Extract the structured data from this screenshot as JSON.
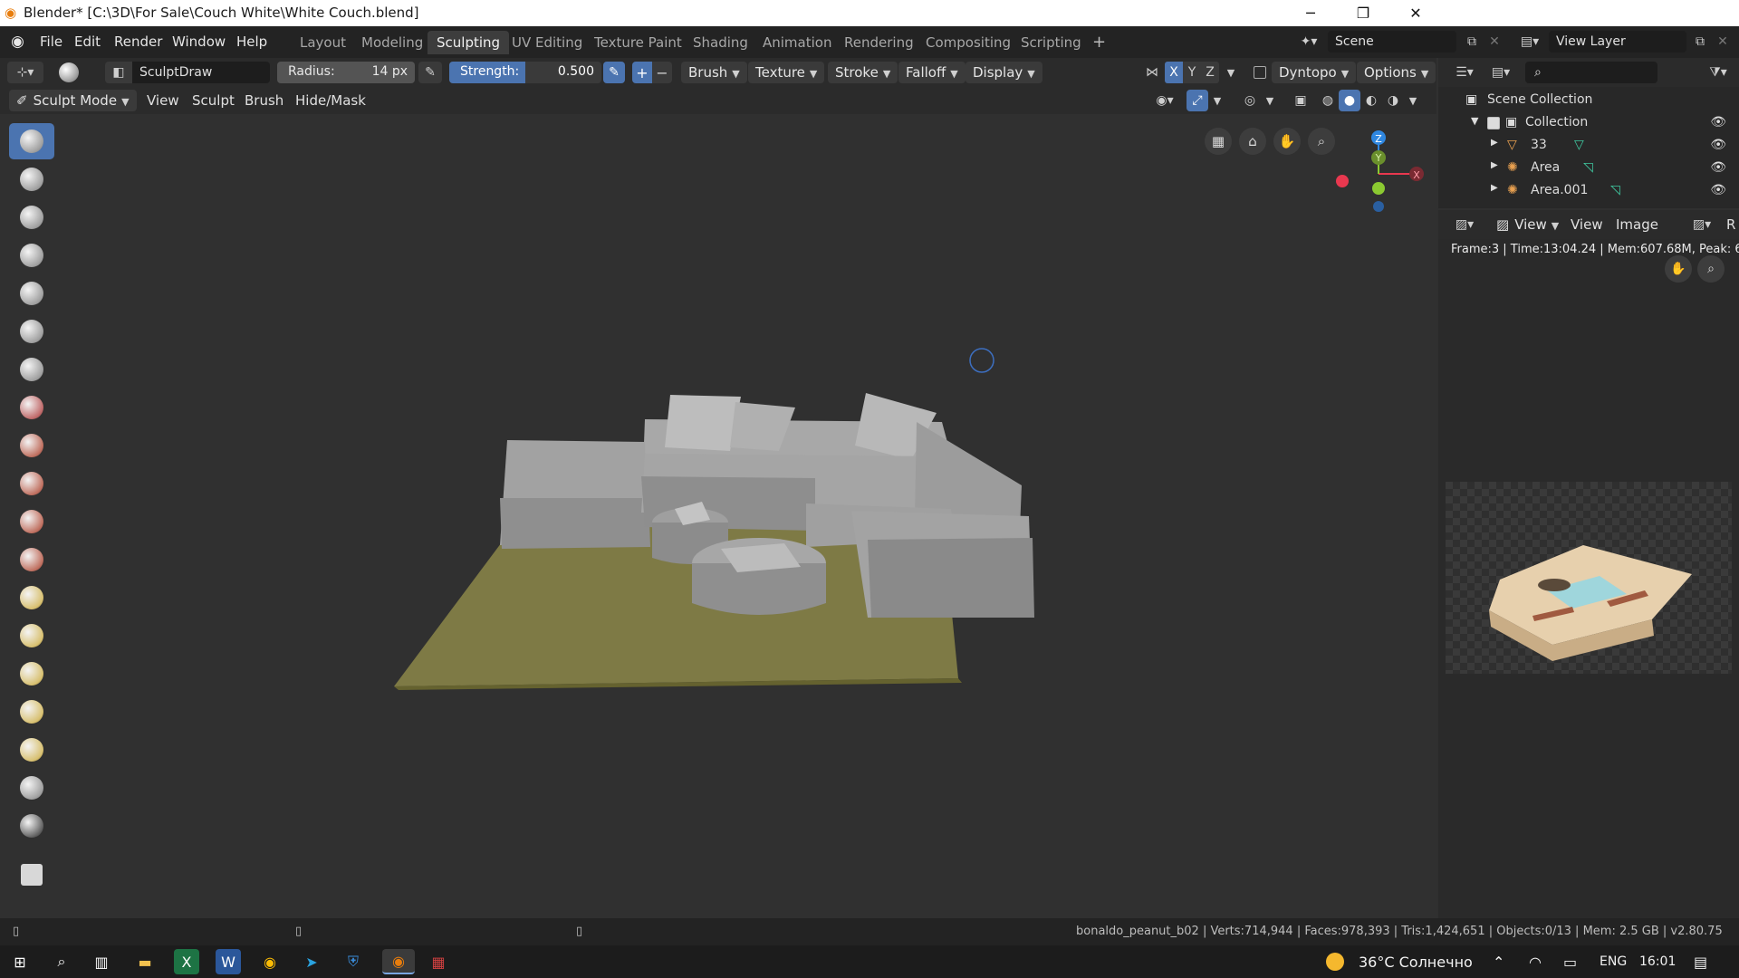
{
  "window": {
    "title": "Blender* [C:\\3D\\For Sale\\Couch White\\White Couch.blend]",
    "minimize": "─",
    "restore": "❐",
    "close": "✕"
  },
  "menu": {
    "file": "File",
    "edit": "Edit",
    "render": "Render",
    "window": "Window",
    "help": "Help"
  },
  "workspaces": {
    "layout": "Layout",
    "modeling": "Modeling",
    "sculpting": "Sculpting",
    "uv": "UV Editing",
    "texture": "Texture Paint",
    "shading": "Shading",
    "animation": "Animation",
    "rendering": "Rendering",
    "compositing": "Compositing",
    "scripting": "Scripting",
    "add": "+"
  },
  "scene": {
    "name": "Scene",
    "view_layer": "View Layer"
  },
  "tool_header": {
    "brush_name": "SculptDraw",
    "radius_label": "Radius:",
    "radius_value": "14 px",
    "strength_label": "Strength:",
    "strength_value": "0.500",
    "brush": "Brush",
    "texture": "Texture",
    "stroke": "Stroke",
    "falloff": "Falloff",
    "display": "Display",
    "axis_x": "X",
    "axis_y": "Y",
    "axis_z": "Z",
    "dyntopo": "Dyntopo",
    "options": "Options"
  },
  "view_header": {
    "mode": "Sculpt Mode",
    "view": "View",
    "sculpt": "Sculpt",
    "brush": "Brush",
    "hide_mask": "Hide/Mask"
  },
  "gizmo": {
    "z": "Z",
    "y": "Y",
    "x": "X"
  },
  "outliner": {
    "scene_collection": "Scene Collection",
    "items": [
      {
        "label": "Collection"
      },
      {
        "label": "33"
      },
      {
        "label": "Area"
      },
      {
        "label": "Area.001"
      }
    ]
  },
  "image_editor": {
    "view1": "View",
    "view2": "View",
    "image": "Image",
    "r": "R",
    "render_info": "Frame:3 | Time:13:04.24 | Mem:607.68M, Peak: 6"
  },
  "status_bar": {
    "info": "bonaldo_peanut_b02 | Verts:714,944 | Faces:978,393 | Tris:1,424,651 | Objects:0/13 | Mem: 2.5 GB | v2.80.75"
  },
  "taskbar": {
    "weather": "36°C Солнечно",
    "lang": "ENG",
    "time": "16:01"
  },
  "colors": {
    "accent": "#4b74b0",
    "axis_x": "#e8384f",
    "axis_y": "#8bc931",
    "axis_z": "#2f87e0",
    "rug": "#7e7a45",
    "couch": "#9a9a9a"
  }
}
